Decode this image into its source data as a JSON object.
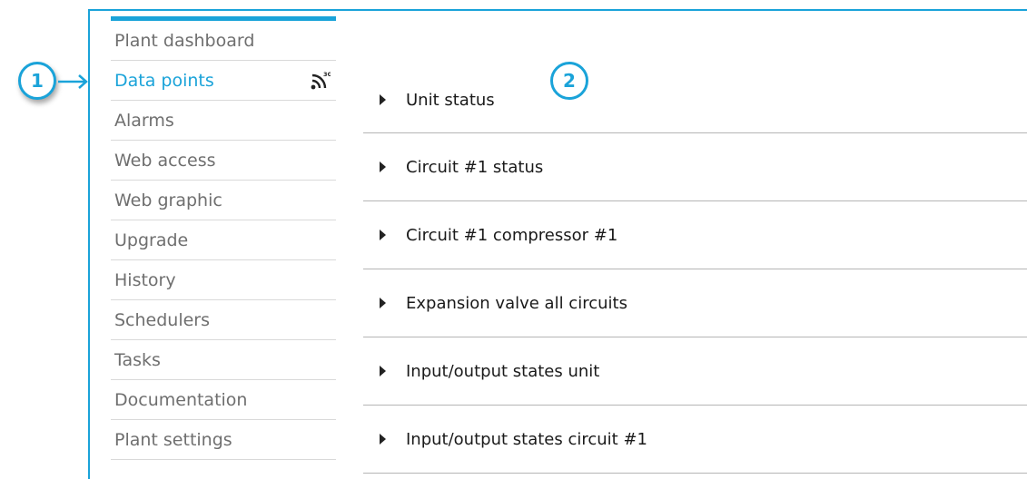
{
  "sidebar": {
    "items": [
      {
        "label": "Plant dashboard"
      },
      {
        "label": "Data points",
        "active": true,
        "badge_icon": "3g-signal-icon",
        "badge_text": "3G"
      },
      {
        "label": "Alarms"
      },
      {
        "label": "Web access"
      },
      {
        "label": "Web graphic"
      },
      {
        "label": "Upgrade"
      },
      {
        "label": "History"
      },
      {
        "label": "Schedulers"
      },
      {
        "label": "Tasks"
      },
      {
        "label": "Documentation"
      },
      {
        "label": "Plant settings"
      }
    ]
  },
  "main": {
    "sections": [
      {
        "label": "Unit status",
        "icon": "expand-caret-icon"
      },
      {
        "label": "Circuit #1 status",
        "icon": "expand-caret-icon"
      },
      {
        "label": "Circuit #1 compressor #1",
        "icon": "expand-caret-icon"
      },
      {
        "label": "Expansion valve all circuits",
        "icon": "expand-caret-icon"
      },
      {
        "label": "Input/output states unit",
        "icon": "expand-caret-icon"
      },
      {
        "label": "Input/output states circuit #1",
        "icon": "expand-caret-icon"
      }
    ]
  },
  "annotations": {
    "callout_1": "1",
    "callout_2": "2"
  },
  "colors": {
    "accent": "#1aa3d9",
    "sidebar_text": "#6f6f6f",
    "row_text": "#1a1a1a",
    "divider": "#b5b5b5"
  }
}
